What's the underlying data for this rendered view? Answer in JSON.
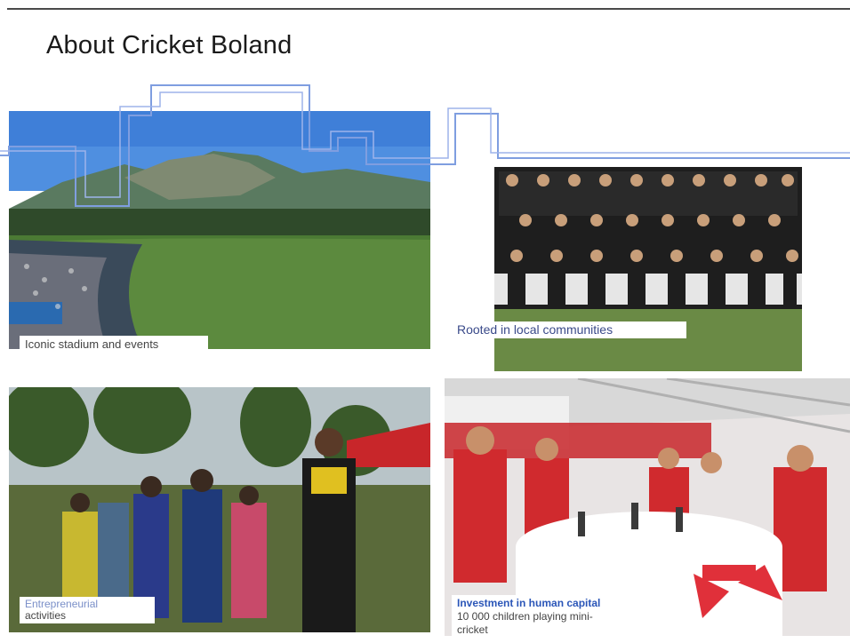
{
  "slide": {
    "title": "About Cricket Boland"
  },
  "captions": {
    "stadium": "Iconic stadium and events",
    "community": "Rooted in local communities",
    "entrepreneur_line1": "Entrepreneurial",
    "entrepreneur_line2": "activities",
    "investment_title": "Investment in human capital",
    "investment_line1": "10 000 children playing mini-",
    "investment_line2": "cricket"
  },
  "colors": {
    "accent_blue": "#5b7fd6",
    "caption_highlight": "#2b56b8"
  }
}
